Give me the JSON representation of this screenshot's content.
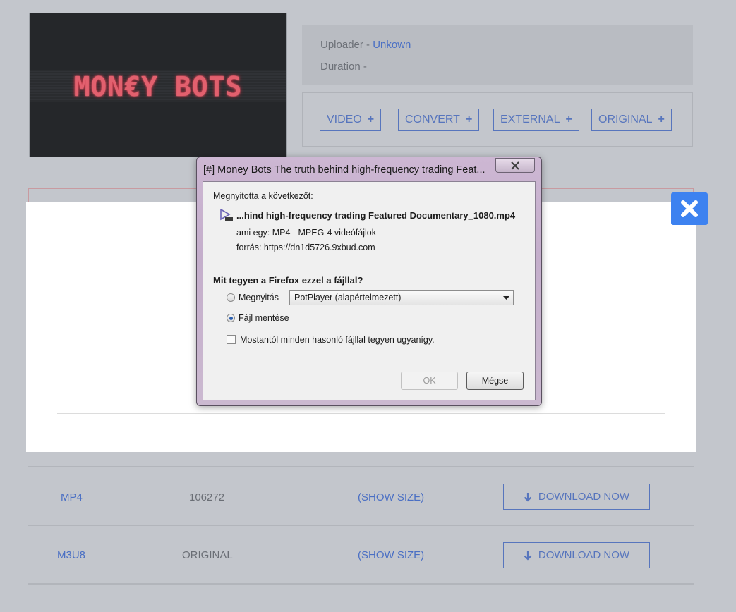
{
  "thumbnail": {
    "logo_text": "MON€Y BOTS"
  },
  "info": {
    "uploader_label": "Uploader - ",
    "uploader_value": "Unkown",
    "duration_label": "Duration - "
  },
  "tabs": [
    {
      "label": "VIDEO"
    },
    {
      "label": "CONVERT"
    },
    {
      "label": "EXTERNAL"
    },
    {
      "label": "ORIGINAL"
    }
  ],
  "rows": [
    {
      "format": "MP4",
      "id": "106272",
      "size": "(SHOW SIZE)",
      "button": "DOWNLOAD NOW"
    },
    {
      "format": "M3U8",
      "id": "ORIGINAL",
      "size": "(SHOW SIZE)",
      "button": "DOWNLOAD NOW"
    }
  ],
  "dialog": {
    "title": "[#] Money Bots The truth behind high-frequency trading Feat...",
    "opened_label": "Megnyitotta a következőt:",
    "filename": "...hind high-frequency trading Featured Documentary_1080.mp4",
    "type_line": "ami egy:  MP4 - MPEG-4 videófájlok",
    "source_line": "forrás:  https://dn1d5726.9xbud.com",
    "question": "Mit tegyen a Firefox ezzel a fájllal?",
    "open_label": "Megnyitás",
    "open_app": "PotPlayer (alapértelmezett)",
    "save_label": "Fájl mentése",
    "remember_label": "Mostantól minden hasonló fájllal tegyen ugyanígy.",
    "ok_label": "OK",
    "cancel_label": "Mégse",
    "selected_option": "save"
  },
  "colors": {
    "accent": "#5775bd",
    "link": "#4a6fc4",
    "close_button": "#3d82f0",
    "background": "#c3c6cc"
  }
}
